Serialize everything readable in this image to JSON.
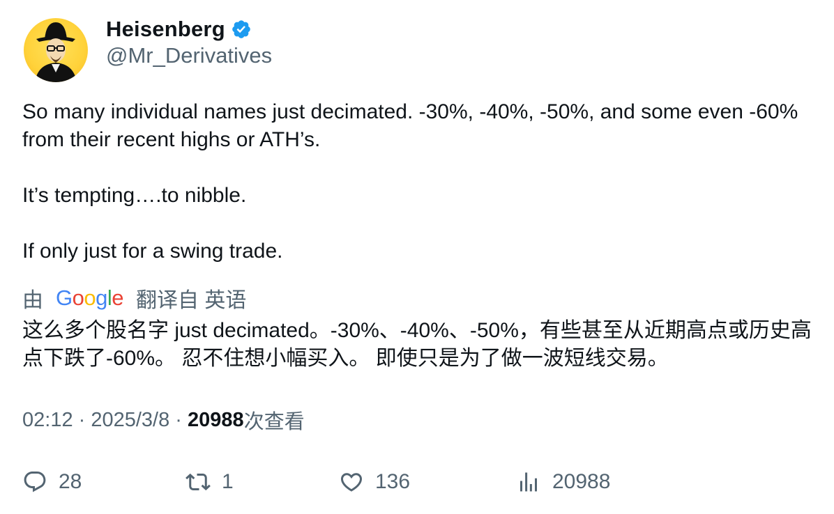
{
  "author": {
    "display_name": "Heisenberg",
    "handle": "@Mr_Derivatives",
    "verified": true,
    "avatar_icon": "heisenberg-avatar-icon"
  },
  "tweet": {
    "paragraphs": [
      "So many individual names just decimated. -30%, -40%, -50%, and some even -60% from their recent highs or ATH’s.",
      "It’s tempting….to nibble.",
      "If only just for a swing trade."
    ]
  },
  "translation": {
    "prefix": "由",
    "provider_letters": [
      "G",
      "o",
      "o",
      "g",
      "l",
      "e"
    ],
    "suffix": "翻译自 英语",
    "text": "这么多个股名字 just decimated。-30%、-40%、-50%，有些甚至从近期高点或历史高点下跌了-60%。 忍不住想小幅买入。 即使只是为了做一波短线交易。"
  },
  "meta": {
    "time": "02:12",
    "sep1": " · ",
    "date": "2025/3/8",
    "sep2": " · ",
    "views": "20988",
    "views_label": "次查看"
  },
  "actions": {
    "replies": "28",
    "retweets": "1",
    "likes": "136",
    "views": "20988"
  },
  "colors": {
    "text": "#0f1419",
    "secondary": "#536471",
    "verified": "#1d9bf0",
    "avatar_bg": "#ffd23a"
  }
}
